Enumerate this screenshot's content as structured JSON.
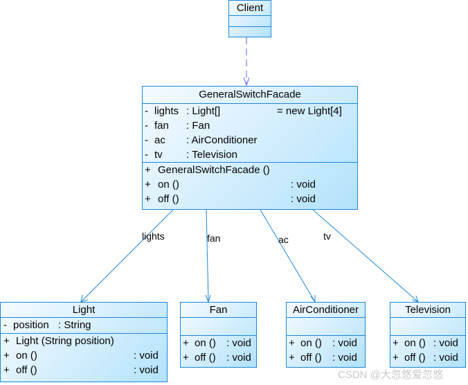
{
  "classes": {
    "client": {
      "name": "Client"
    },
    "facade": {
      "name": "GeneralSwitchFacade",
      "attributes": [
        {
          "vis": "-",
          "name": "lights",
          "type": ": Light[]",
          "init": "= new Light[4]"
        },
        {
          "vis": "-",
          "name": "fan",
          "type": ": Fan",
          "init": ""
        },
        {
          "vis": "-",
          "name": "ac",
          "type": ": AirConditioner",
          "init": ""
        },
        {
          "vis": "-",
          "name": "tv",
          "type": ": Television",
          "init": ""
        }
      ],
      "operations": [
        {
          "vis": "+",
          "name": "GeneralSwitchFacade ()",
          "ret": ""
        },
        {
          "vis": "+",
          "name": "on ()",
          "ret": ": void"
        },
        {
          "vis": "+",
          "name": "off ()",
          "ret": ": void"
        }
      ]
    },
    "light": {
      "name": "Light",
      "attributes": [
        {
          "vis": "-",
          "name": "position",
          "type": ": String"
        }
      ],
      "operations": [
        {
          "vis": "+",
          "name": "Light (String position)",
          "ret": ""
        },
        {
          "vis": "+",
          "name": "on ()",
          "ret": ": void"
        },
        {
          "vis": "+",
          "name": "off ()",
          "ret": ": void"
        }
      ]
    },
    "fan": {
      "name": "Fan",
      "operations": [
        {
          "vis": "+",
          "name": "on ()",
          "ret": ": void"
        },
        {
          "vis": "+",
          "name": "off ()",
          "ret": ": void"
        }
      ]
    },
    "airconditioner": {
      "name": "AirConditioner",
      "operations": [
        {
          "vis": "+",
          "name": "on ()",
          "ret": ": void"
        },
        {
          "vis": "+",
          "name": "off ()",
          "ret": ": void"
        }
      ]
    },
    "television": {
      "name": "Television",
      "operations": [
        {
          "vis": "+",
          "name": "on ()",
          "ret": ": void"
        },
        {
          "vis": "+",
          "name": "off ()",
          "ret": ": void"
        }
      ]
    }
  },
  "associations": {
    "lights": "lights",
    "fan": "fan",
    "ac": "ac",
    "tv": "tv"
  },
  "colors": {
    "border": "#1b86d8",
    "dependency": "#7b7be8",
    "association": "#1b86d8"
  },
  "watermark": "CSDN @大忽悠爱忽悠"
}
